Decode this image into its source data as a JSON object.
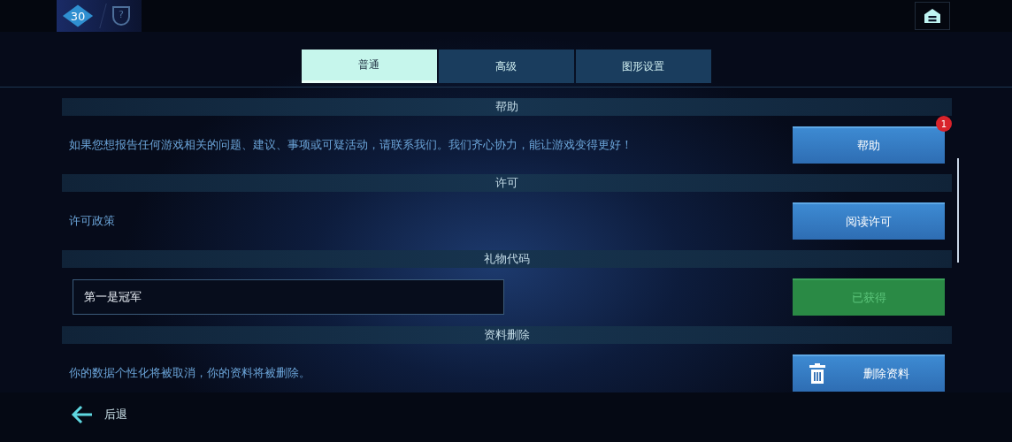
{
  "top_bar": {
    "level": "30",
    "help": "?"
  },
  "tabs": [
    {
      "label": "普通",
      "selected": true
    },
    {
      "label": "高级",
      "selected": false
    },
    {
      "label": "图形设置",
      "selected": false
    }
  ],
  "sections": [
    {
      "header": "帮助",
      "kind": "text",
      "text": "如果您想报告任何游戏相关的问题、建议、事项或可疑活动，请联系我们。我们齐心协力，能让游戏变得更好！",
      "button": {
        "label": "帮助",
        "kind": "normal",
        "badge": "1"
      }
    },
    {
      "header": "许可",
      "kind": "text",
      "text": "许可政策",
      "button": {
        "label": "阅读许可",
        "kind": "normal"
      }
    },
    {
      "header": "礼物代码",
      "kind": "input",
      "value": "第一是冠军",
      "button": {
        "label": "已获得",
        "kind": "done"
      }
    },
    {
      "header": "资料删除",
      "kind": "text",
      "text": "你的数据个性化将被取消，你的资料将被删除。",
      "button": {
        "label": "删除资料",
        "kind": "delete"
      }
    }
  ],
  "back": {
    "label": "后退"
  }
}
